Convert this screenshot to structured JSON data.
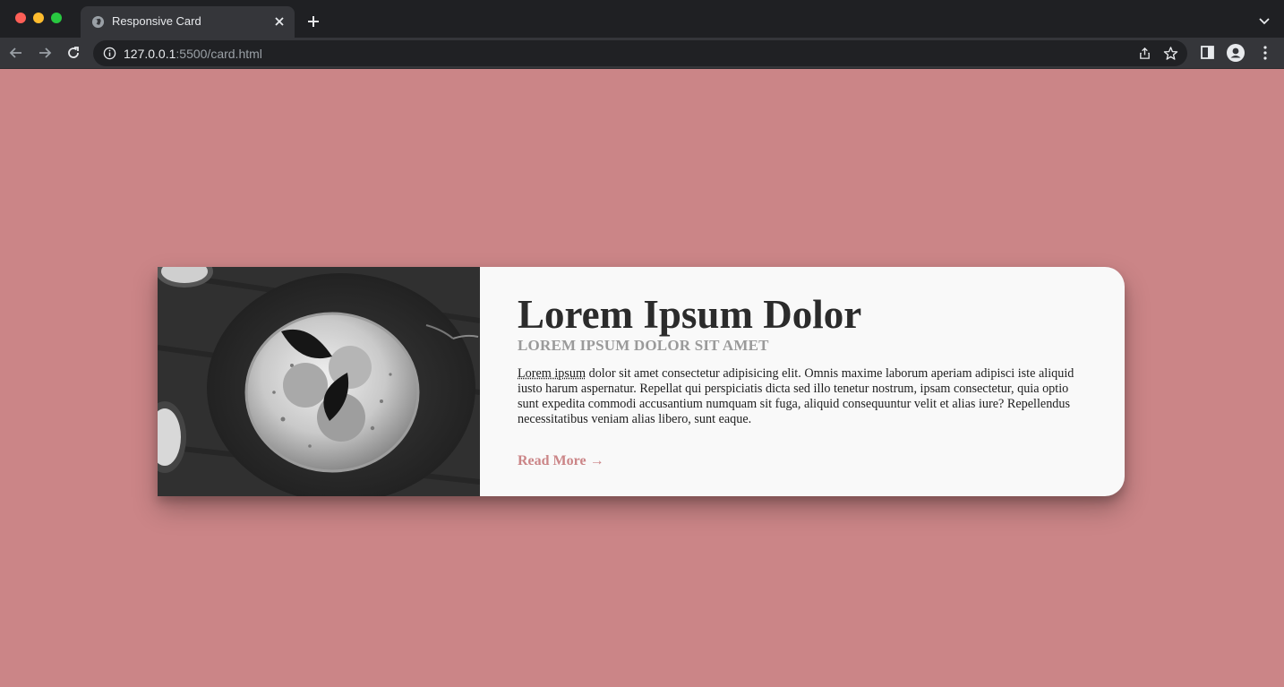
{
  "browser": {
    "tab_title": "Responsive Card",
    "url_host": "127.0.0.1",
    "url_rest": ":5500/card.html"
  },
  "colors": {
    "page_background": "#cb8587",
    "card_background": "#f9f9f9",
    "title_color": "#2b2b2b",
    "subtitle_color": "#9a9a9a",
    "link_color": "#cb8587"
  },
  "card": {
    "title": "Lorem Ipsum Dolor",
    "subtitle": "LOREM IPSUM DOLOR SIT AMET",
    "text_abbr": "Lorem ipsum",
    "text_rest": " dolor sit amet consectetur adipisicing elit. Omnis maxime laborum aperiam adipisci iste aliquid iusto harum aspernatur. Repellat qui perspiciatis dicta sed illo tenetur nostrum, ipsam consectetur, quia optio sunt expedita commodi accusantium numquam sit fuga, aliquid consequuntur velit et alias iure? Repellendus necessitatibus veniam alias libero, sunt eaque.",
    "read_more": "Read More →"
  },
  "icons": {
    "favicon": "globe-icon",
    "image": "cake-photo"
  }
}
